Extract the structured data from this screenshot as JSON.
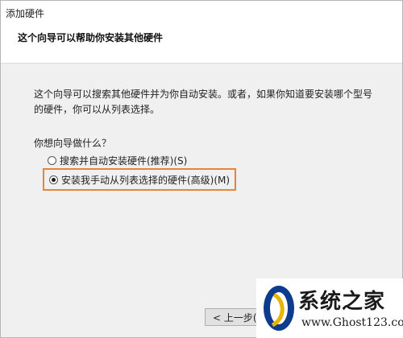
{
  "window": {
    "title": "添加硬件"
  },
  "header": {
    "title": "这个向导可以帮助你安装其他硬件"
  },
  "content": {
    "description": "这个向导可以搜索其他硬件并为你自动安装。或者，如果你知道要安装哪个型号的硬件，你可以从列表选择。",
    "question": "你想向导做什么？",
    "options": [
      {
        "label": "搜索并自动安装硬件(推荐)(S)",
        "selected": false
      },
      {
        "label": "安装我手动从列表选择的硬件(高级)(M)",
        "selected": true
      }
    ],
    "highlight_color": "#e8833a"
  },
  "footer": {
    "back_label": "< 上一步(B)"
  },
  "watermark": {
    "site_name": "系统之家",
    "url": "www.Ghost123.com"
  }
}
